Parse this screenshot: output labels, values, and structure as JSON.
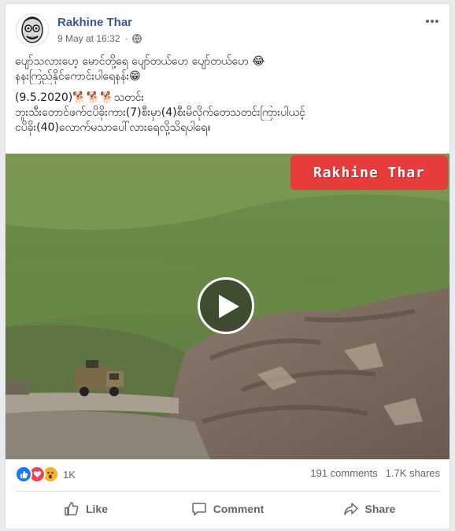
{
  "post": {
    "author": "Rakhine Thar",
    "timestamp": "9 May at 16:32",
    "privacy_icon": "globe-icon",
    "text_lines": [
      "ပျော်သလားဟေ့ မောင်တို့ရေ ပျော်တယ်ဟေ ပျော်တယ်ဟေ 😂",
      "နနးကြည်နိုင်ကောင်းပါရေနန်း😁",
      "(9.5.2020)🐕🐕🐕သတင်း",
      "ဘူးသီးတောင်ဖက်ငပိခိုးကား(7)စီးမှာ(4)စီးမိလိုက်တေသတင်းကြားပါယင့်",
      "ငပိခိုး(40)လောက်မသာပေါ်လားရေလို့သိရပါရေ။"
    ],
    "video": {
      "watermark": "Rakhine Thar",
      "play_icon": "play-icon"
    },
    "stats": {
      "reactions": [
        "like",
        "love",
        "wow"
      ],
      "reaction_count": "1K",
      "comments": "191 comments",
      "shares": "1.7K shares"
    },
    "actions": {
      "like": "Like",
      "comment": "Comment",
      "share": "Share"
    }
  },
  "colors": {
    "name": "#385898",
    "meta": "#606770",
    "like": "#1877f2",
    "love": "#f33e58",
    "wow": "#f7b125",
    "watermark_bg": "#e83b3b"
  }
}
